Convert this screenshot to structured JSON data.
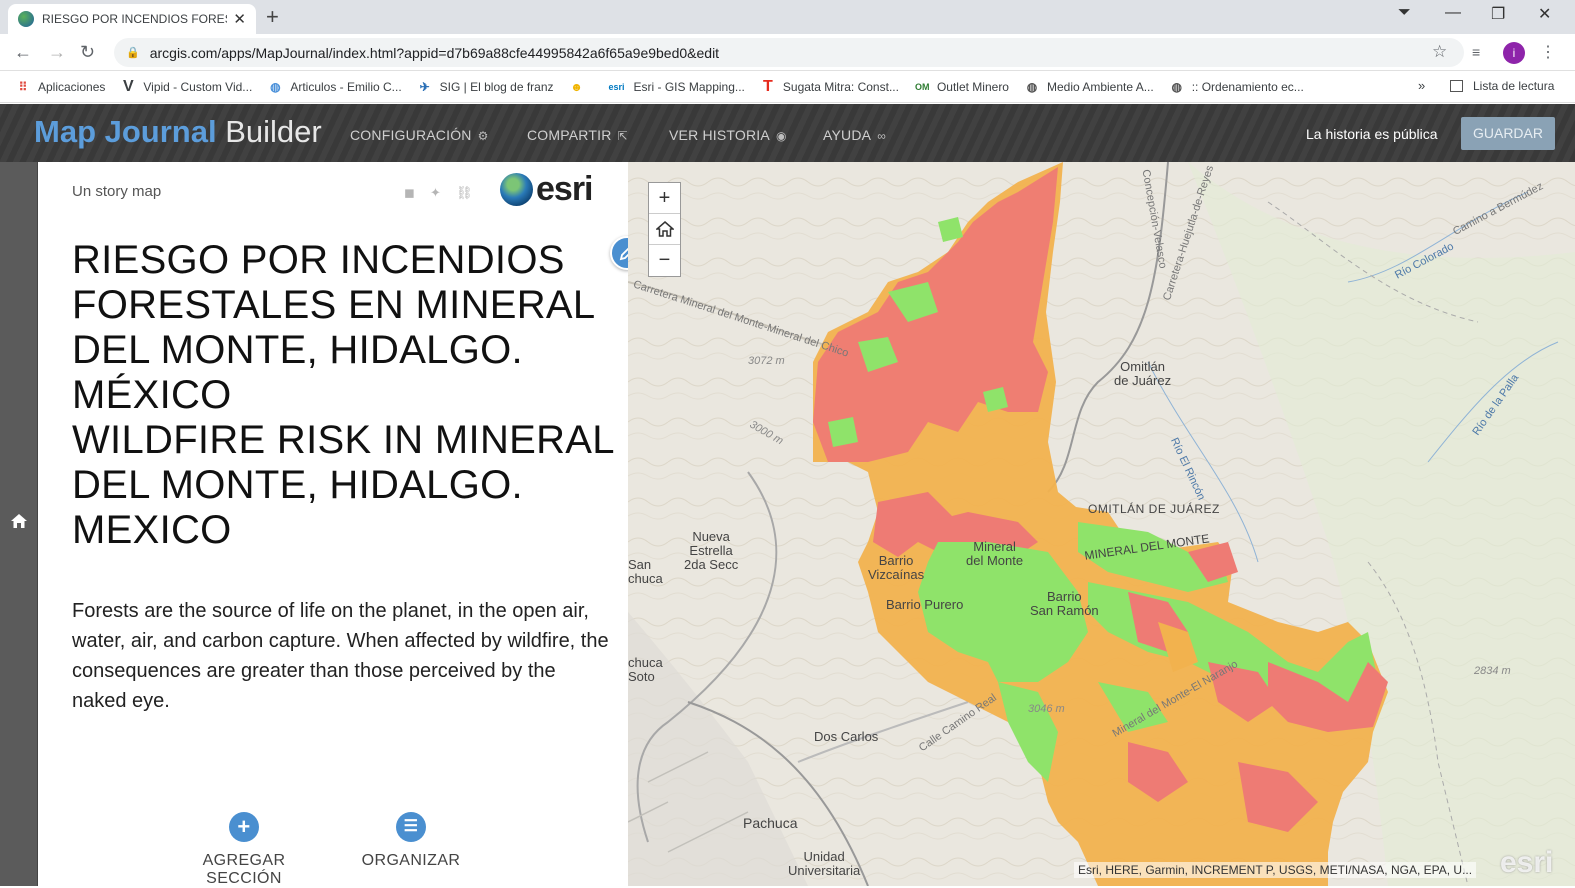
{
  "browser": {
    "tab_title": "RIESGO  POR INCENDIOS FORES",
    "url": "arcgis.com/apps/MapJournal/index.html?appid=d7b69a88cfe44995842a6f65a9e9bed0&edit",
    "avatar_letter": "i",
    "bookmarks": [
      {
        "label": "Aplicaciones",
        "icon": "apps-grid-icon"
      },
      {
        "label": "Vipid - Custom Vid...",
        "icon": "vipid-logo-icon"
      },
      {
        "label": "Articulos - Emilio C...",
        "icon": "globe-icon"
      },
      {
        "label": "SIG | El blog de franz",
        "icon": "satellite-icon"
      },
      {
        "label": "",
        "icon": "emoji-icon"
      },
      {
        "label": "Esri - GIS Mapping...",
        "icon": "esri-logo-icon"
      },
      {
        "label": "Sugata Mitra: Const...",
        "icon": "ted-logo-icon"
      },
      {
        "label": "Outlet Minero",
        "icon": "outlet-logo-icon"
      },
      {
        "label": "Medio Ambiente A...",
        "icon": "globe-icon"
      },
      {
        "label": ":: Ordenamiento ec...",
        "icon": "globe-icon"
      }
    ],
    "bookmarks_more": "»",
    "reading_list": "Lista de lectura"
  },
  "builder": {
    "brand_bold": "Map Journal",
    "brand_light": "Builder",
    "menu": [
      {
        "label": "CONFIGURACIÓN",
        "icon": "gears-icon"
      },
      {
        "label": "COMPARTIR",
        "icon": "share-icon"
      },
      {
        "label": "VER HISTORIA",
        "icon": "eye-icon"
      },
      {
        "label": "AYUDA",
        "icon": "binoculars-icon"
      }
    ],
    "public_status": "La historia es pública",
    "save_label": "GUARDAR"
  },
  "panel": {
    "storymap_label": "Un story map",
    "esri_logo": "esri",
    "title_lines": [
      "RIESGO POR INCENDIOS",
      "FORESTALES EN MINERAL",
      "DEL MONTE, HIDALGO.",
      "MÉXICO",
      "WILDFIRE RISK IN MINERAL",
      "DEL MONTE, HIDALGO.",
      "MEXICO"
    ],
    "body": "Forests are the source of life on the planet, in the open air, water, air, and carbon capture. When affected by wildfire, the consequences are greater than those perceived by the naked eye.",
    "add_section": "AGREGAR SECCIÓN",
    "organize": "ORGANIZAR"
  },
  "map": {
    "zoom_in": "+",
    "zoom_out": "−",
    "attribution": "Esri, HERE, Garmin, INCREMENT P, USGS, METI/NASA, NGA, EPA, U...",
    "powered": "esri",
    "risk_colors": {
      "high": "#ee7b74",
      "medium": "#f2b24e",
      "low": "#8fe36a"
    },
    "labels": {
      "omitlan": "Omitlán\nde Juárez",
      "omitlan_caps": "OMITLÁN DE JUÁREZ",
      "nueva_estrella": "Nueva\nEstrella\n2da Secc",
      "san_chuca": "San\nchuca",
      "barrio_vizcainas": "Barrio\nVizcaínas",
      "mineral_monte": "Mineral\ndel Monte",
      "barrio_purero": "Barrio Purero",
      "barrio_san_ramon": "Barrio\nSan Ramón",
      "mineral_caps": "MINERAL DEL MONTE",
      "chuca_soto": "chuca\nSoto",
      "dos_carlos": "Dos Carlos",
      "pachuca": "Pachuca",
      "unidad": "Unidad\nUniversitaria",
      "elev_3072": "3072 m",
      "elev_3046": "3046 m",
      "elev_2834": "2834 m",
      "elev_3000": "3000 m",
      "rio_colorado": "Río Colorado",
      "rio_la_palla": "Río de la Palla",
      "rio_rincon": "Río El Rincón",
      "carr_mineral": "Carretera Mineral del Monte-Mineral del Chico",
      "carr_huejutla": "Carretera-Huejutla-de-Reyes",
      "concepcion": "Concepción-Velasco",
      "camino_real": "Calle Camino Real",
      "camino_bermudez": "Camino a Bermúdez",
      "mineral_naranjos": "Mineral del Monte-El Naranjo"
    }
  }
}
